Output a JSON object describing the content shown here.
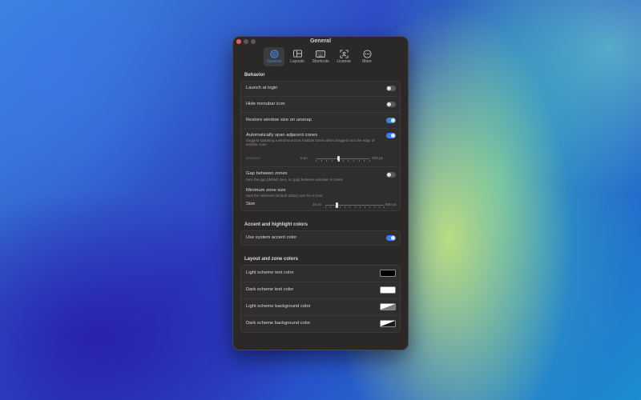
{
  "window": {
    "title": "General"
  },
  "toolbar": {
    "items": [
      {
        "label": "General",
        "icon": "gear-icon",
        "active": true
      },
      {
        "label": "Layouts",
        "icon": "layout-icon",
        "active": false
      },
      {
        "label": "Shortcuts",
        "icon": "keyboard-icon",
        "active": false
      },
      {
        "label": "License",
        "icon": "license-icon",
        "active": false
      },
      {
        "label": "More",
        "icon": "more-icon",
        "active": false
      }
    ]
  },
  "behavior": {
    "title": "Behavior",
    "launch_at_login": {
      "label": "Launch at login",
      "on": false
    },
    "hide_menubar_icon": {
      "label": "Hide menubar icon",
      "on": false
    },
    "restore_window_size": {
      "label": "Restore window size on unsnap",
      "on": true
    },
    "span_zones": {
      "label": "Automatically span adjacent zones",
      "desc": "Suggest spanning a window across multiple zones when dragged near the edge of another zone",
      "on": true,
      "distance_label": "Distance",
      "min": "0 px",
      "max": "100 px",
      "value_fraction": 0.42
    },
    "gap_between_zones": {
      "label": "Gap between zones",
      "desc": "Sets the gap (default zero, no gap) between windows in zones",
      "on": false
    },
    "min_zone_size": {
      "label": "Minimum zone size",
      "desc": "Sets the minimum (default 100px) size for a zone",
      "size_label": "Size",
      "min": "16 px",
      "max": "500 px",
      "value_fraction": 0.2
    }
  },
  "accent": {
    "title": "Accent and highlight colors",
    "use_system_accent": {
      "label": "Use system accent color",
      "on": true
    }
  },
  "layout_colors": {
    "title": "Layout and zone colors",
    "light_text": {
      "label": "Light scheme text color",
      "color": "#000000"
    },
    "dark_text": {
      "label": "Dark scheme text color",
      "color": "#ffffff"
    },
    "light_bg": {
      "label": "Light scheme background color",
      "color_a": "#ffffff",
      "color_b": "#7a7a7a"
    },
    "dark_bg": {
      "label": "Dark scheme background color",
      "color_a": "#ffffff",
      "color_b": "#1a1a1a"
    }
  },
  "colors": {
    "accent": "#3a82f0"
  }
}
